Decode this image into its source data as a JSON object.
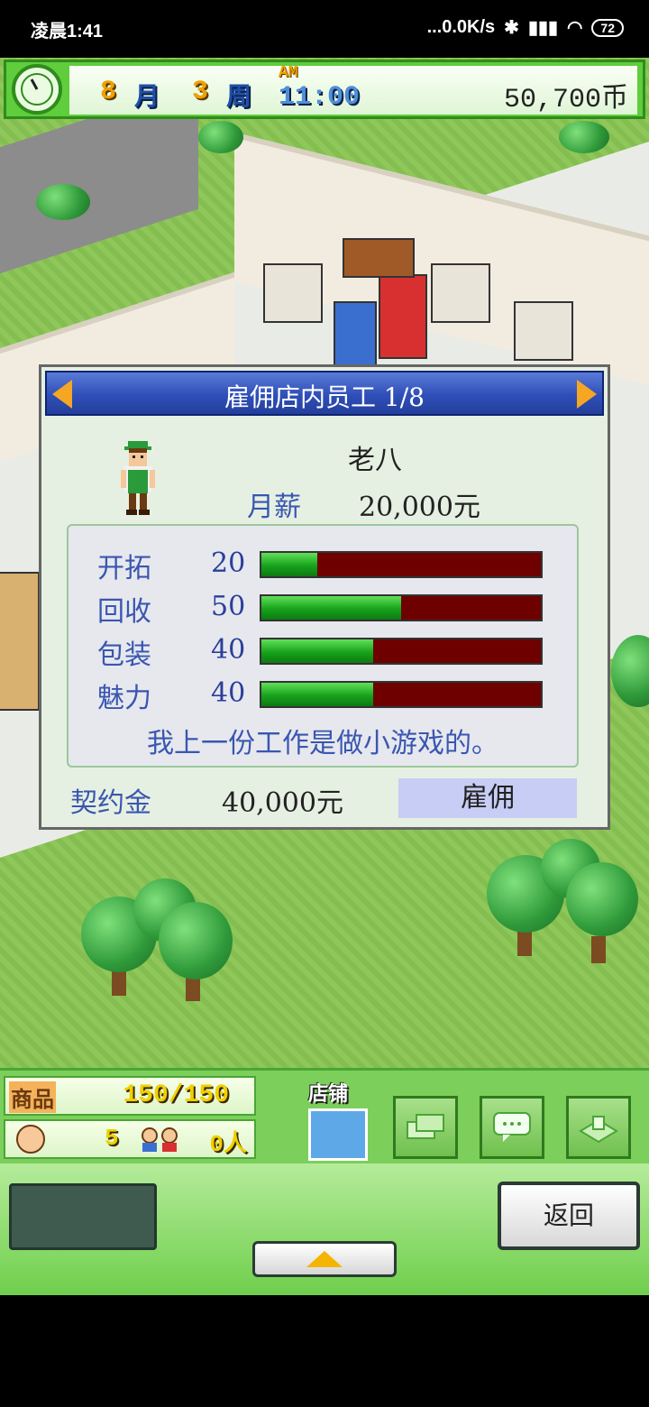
{
  "status_bar": {
    "time": "凌晨1:41",
    "network": "...0.0K/s",
    "battery": "72"
  },
  "top_hud": {
    "month_num": "8",
    "month_unit": "月",
    "week_num": "3",
    "week_unit": "周",
    "ampm": "AM",
    "game_time": "11:00",
    "money": "50,700币"
  },
  "dialog": {
    "title": "雇佣店内员工 1/8",
    "employee_name": "老八",
    "salary_label": "月薪",
    "salary_value": "20,000元",
    "stats": [
      {
        "name": "开拓",
        "value": "20",
        "level": 0.2
      },
      {
        "name": "回收",
        "value": "50",
        "level": 0.5
      },
      {
        "name": "包装",
        "value": "40",
        "level": 0.4
      },
      {
        "name": "魅力",
        "value": "40",
        "level": 0.4
      }
    ],
    "quote": "我上一份工作是做小游戏的。",
    "contract_label": "契约金",
    "contract_value": "40,000元",
    "hire_label": "雇佣"
  },
  "bottom_hud": {
    "goods_label": "商品",
    "goods_value": "150/150",
    "visitors_value": "5",
    "people_value": "0人",
    "shop_label": "店铺",
    "back_label": "返回"
  },
  "colors": {
    "hud_green": "#5fcd3c",
    "dialog_header_blue": "#2f4fb8",
    "stat_fill_green": "#17a21b",
    "stat_empty_red": "#6e0000",
    "hire_button_bg": "#c8cdf5"
  },
  "icons": [
    "clock-icon",
    "left-arrow-icon",
    "right-arrow-icon",
    "smile-face-icon",
    "kids-icon",
    "store-icon",
    "money-stack-icon",
    "chat-bubble-icon",
    "map-icon",
    "up-triangle-icon"
  ]
}
